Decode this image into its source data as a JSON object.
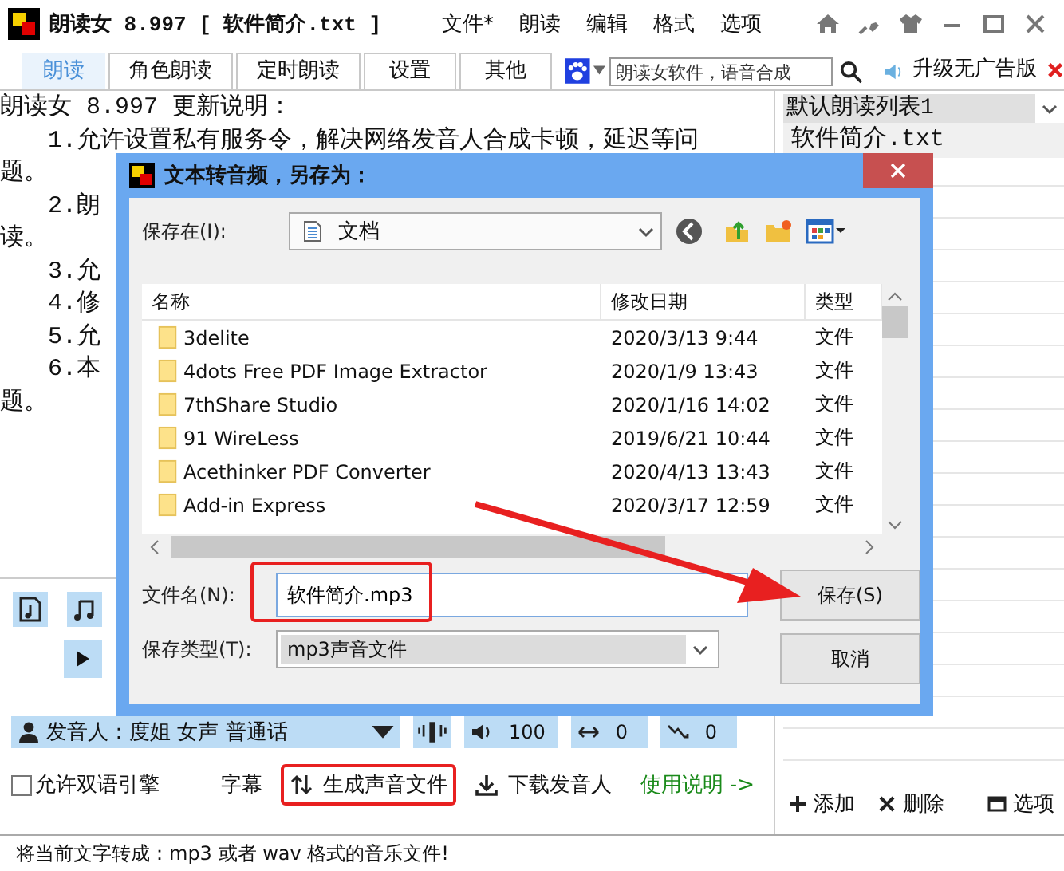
{
  "window": {
    "title": "朗读女 8.997 [ 软件简介.txt ]"
  },
  "menu": [
    "文件*",
    "朗读",
    "编辑",
    "格式",
    "选项"
  ],
  "tabs": [
    {
      "label": "朗读",
      "selected": true
    },
    {
      "label": "角色朗读",
      "selected": false
    },
    {
      "label": "定时朗读",
      "selected": false
    },
    {
      "label": "设置",
      "selected": false
    },
    {
      "label": "其他",
      "selected": false
    }
  ],
  "search": {
    "value": "朗读女软件，语音合成"
  },
  "upgrade": "升级无广告版",
  "editor": {
    "lines": [
      "朗读女 8.997 更新说明：",
      "　　1.允许设置私有服务令，解决网络发音人合成卡顿，延迟等问",
      "题。",
      "　　2.朗",
      "读。",
      "　　3.允",
      "　　4.修",
      "　　5.允",
      "　　6.本",
      "题。"
    ]
  },
  "playlist": {
    "name": "默认朗读列表1",
    "items": [
      {
        "label": "软件简介.txt",
        "selected": true
      }
    ]
  },
  "playlist_buttons": [
    {
      "label": "添加",
      "kind": "add"
    },
    {
      "label": "删除",
      "kind": "delete"
    },
    {
      "label": "选项",
      "kind": "options"
    }
  ],
  "voice": {
    "speaker": "发音人：度姐 女声 普通话",
    "volume": "100",
    "speed": "0",
    "pitch": "0"
  },
  "dual_engine": {
    "label": "允许双语引擎",
    "checked": false
  },
  "actions": [
    {
      "label": "字幕",
      "kind": "text",
      "highlighted": false
    },
    {
      "label": "生成声音文件",
      "kind": "generate",
      "highlighted": true
    },
    {
      "label": "下载发音人",
      "kind": "download",
      "highlighted": false
    },
    {
      "label": "使用说明 ->",
      "kind": "link",
      "highlighted": false
    }
  ],
  "status_bar": "将当前文字转成：mp3 或者 wav 格式的音乐文件!",
  "dialog": {
    "title": "文本转音频，另存为：",
    "save_in_label": "保存在(I):",
    "location": "文档",
    "columns": [
      "名称",
      "修改日期",
      "类型"
    ],
    "rows": [
      {
        "name": "3delite",
        "date": "2020/3/13 9:44",
        "type": "文件"
      },
      {
        "name": "4dots Free PDF Image Extractor",
        "date": "2020/1/9 13:43",
        "type": "文件"
      },
      {
        "name": "7thShare Studio",
        "date": "2020/1/16 14:02",
        "type": "文件"
      },
      {
        "name": "91 WireLess",
        "date": "2019/6/21 10:44",
        "type": "文件"
      },
      {
        "name": "Acethinker PDF Converter",
        "date": "2020/4/13 13:43",
        "type": "文件"
      },
      {
        "name": "Add-in Express",
        "date": "2020/3/17 12:59",
        "type": "文件"
      }
    ],
    "filename_label": "文件名(N):",
    "filename": {
      "value": "软件简介.mp3",
      "highlighted": true
    },
    "type_label": "保存类型(T):",
    "file_type": "mp3声音文件",
    "save_button": {
      "label": "保存(S)",
      "arrow_pointer": true
    },
    "cancel_button": "取消"
  }
}
